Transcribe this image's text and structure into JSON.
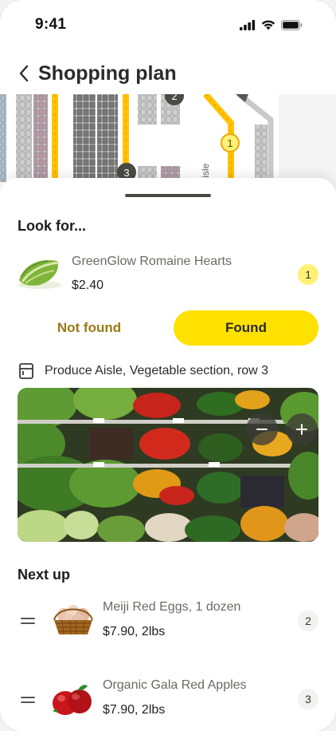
{
  "status_bar": {
    "time": "9:41"
  },
  "header": {
    "title": "Shopping plan"
  },
  "map": {
    "markers": [
      "2",
      "3",
      "1"
    ],
    "aisle_label": "e Aisle"
  },
  "current_item": {
    "section_title": "Look for...",
    "name": "GreenGlow Romaine Hearts",
    "price": "$2.40",
    "quantity": "1",
    "not_found_label": "Not found",
    "found_label": "Found",
    "location": "Produce Aisle, Vegetable section, row 3"
  },
  "next_up": {
    "section_title": "Next up",
    "items": [
      {
        "name": "Meiji Red Eggs, 1 dozen",
        "price": "$7.90, 2lbs",
        "quantity": "2"
      },
      {
        "name": "Organic Gala Red Apples",
        "price": "$7.90, 2lbs",
        "quantity": "3"
      }
    ]
  },
  "colors": {
    "accent": "#ffe100",
    "badge_active": "#fff176",
    "not_found_text": "#9a7a13",
    "map_path": "#ffc400"
  },
  "icons": {
    "back": "chevron-left-icon",
    "location": "store-shelf-icon",
    "zoom_out": "minus-icon",
    "zoom_in": "plus-icon",
    "drag": "drag-handle-icon"
  }
}
